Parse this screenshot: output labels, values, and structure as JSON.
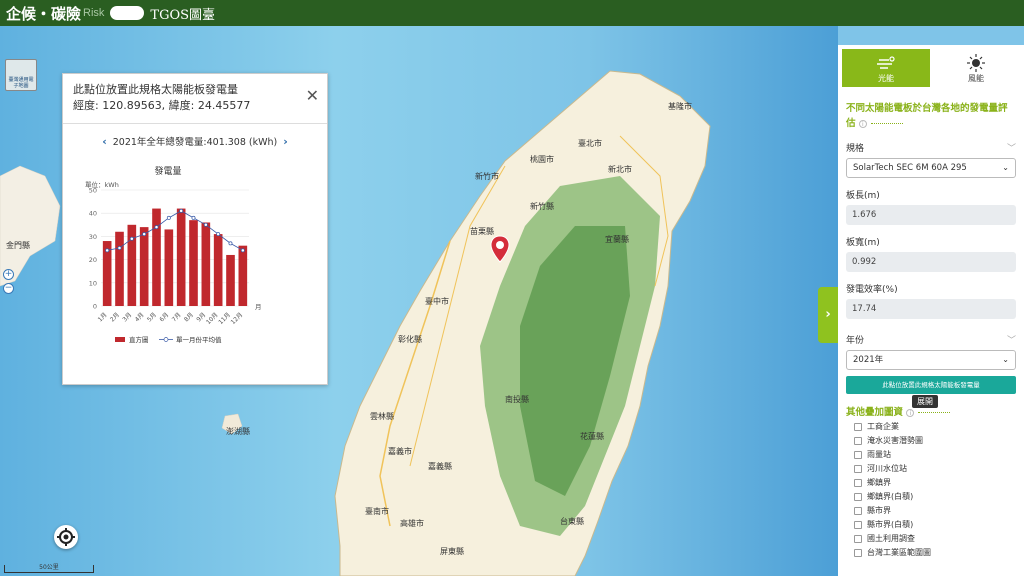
{
  "header": {
    "brand": "企候‧碳險",
    "brand_sub": "Risk",
    "tgos": "TGOS圖臺"
  },
  "map": {
    "thumb_label": "臺灣通用電子地圖",
    "scale_label": "50公里",
    "labels": [
      "金門縣",
      "澎湖縣",
      "基隆市",
      "新北市",
      "臺北市",
      "桃園市",
      "新竹市",
      "新竹縣",
      "苗栗縣",
      "宜蘭縣",
      "臺中市",
      "南投縣",
      "彰化縣",
      "雲林縣",
      "嘉義市",
      "嘉義縣",
      "臺南市",
      "花蓮縣",
      "高雄市",
      "台東縣",
      "屏東縣"
    ]
  },
  "popup": {
    "title": "此點位放置此規格太陽能板發電量",
    "coords": "經度: 120.89563, 緯度: 24.45577",
    "total": "2021年全年總發電量:401.308 (kWh)"
  },
  "chart_data": {
    "type": "bar",
    "title": "發電量",
    "ylabel": "單位：kWh",
    "xlabel": "月",
    "categories": [
      "1月",
      "2月",
      "3月",
      "4月",
      "5月",
      "6月",
      "7月",
      "8月",
      "9月",
      "10月",
      "11月",
      "12月"
    ],
    "ylim": [
      0,
      50
    ],
    "yticks": [
      0,
      10,
      20,
      30,
      40,
      50
    ],
    "series": [
      {
        "name": "直方圖",
        "type": "bar",
        "color": "#c0282d",
        "values": [
          28,
          32,
          35,
          34,
          42,
          33,
          42,
          37,
          36,
          31,
          22,
          26
        ]
      },
      {
        "name": "單一月份平均值",
        "type": "line",
        "color": "#3a5ba8",
        "values": [
          24,
          25,
          29,
          31,
          34,
          38,
          41,
          38,
          35,
          31,
          27,
          24
        ]
      }
    ]
  },
  "panel": {
    "tabs": [
      {
        "label": "光能",
        "active": true
      },
      {
        "label": "風能",
        "active": false
      }
    ],
    "section_title": "不同太陽能電板於台灣各地的發電量評估",
    "spec_label": "規格",
    "spec_value": "SolarTech SEC 6M 60A 295",
    "length_label": "板長(m)",
    "length_value": "1.676",
    "width_label": "板寬(m)",
    "width_value": "0.992",
    "efficiency_label": "發電效率(%)",
    "efficiency_value": "17.74",
    "year_label": "年份",
    "year_value": "2021年",
    "submit_label": "此點位放置此規格太陽能板發電量",
    "layers_title": "其他疊加圖資",
    "layers": [
      "工商企業",
      "淹水災害潛勢圖",
      "雨量站",
      "河川水位站",
      "鄉鎮界",
      "鄉鎮界(白積)",
      "縣市界",
      "縣市界(白積)",
      "國土利用調查",
      "台灣工業區範圍圖"
    ],
    "tooltip": "展開"
  },
  "colors": {
    "header": "#2a5e21",
    "accent": "#89b819",
    "bar": "#c0282d",
    "button": "#1aa89a"
  }
}
